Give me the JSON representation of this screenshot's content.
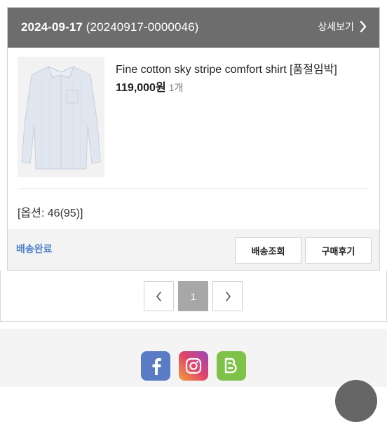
{
  "order": {
    "date": "2024-09-17",
    "order_number": "(20240917-0000046)",
    "detail_link_label": "상세보기",
    "status": "배송완료"
  },
  "product": {
    "name": "Fine cotton sky stripe comfort shirt [품절임박]",
    "price": "119,000원",
    "quantity": "1개",
    "option": "[옵션: 46(95)]"
  },
  "actions": {
    "track_label": "배송조회",
    "review_label": "구매후기"
  },
  "pagination": {
    "prev_icon": "chevron-left-icon",
    "current_page": "1",
    "next_icon": "chevron-right-icon"
  },
  "social": {
    "icons": [
      "facebook-icon",
      "instagram-icon",
      "blog-icon"
    ]
  },
  "colors": {
    "header_bg": "#6d6d6d",
    "status": "#4a7fc6",
    "facebook": "#5a7cc4",
    "blog": "#7fc24a"
  }
}
